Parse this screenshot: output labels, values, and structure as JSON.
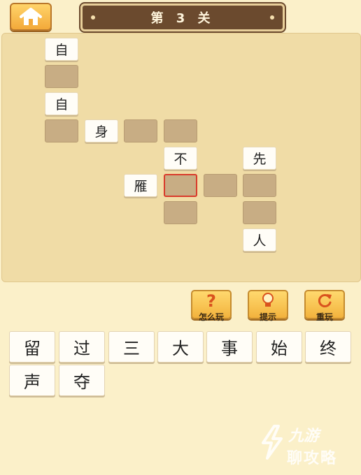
{
  "header": {
    "title": "第 3 关",
    "home_icon": "home-icon"
  },
  "board": {
    "cells": [
      {
        "id": "r1c1",
        "char": "自",
        "state": "given"
      },
      {
        "id": "r2c1",
        "char": "",
        "state": "empty"
      },
      {
        "id": "r3c1",
        "char": "自",
        "state": "given"
      },
      {
        "id": "r4c1",
        "char": "",
        "state": "empty"
      },
      {
        "id": "r4c2",
        "char": "身",
        "state": "given"
      },
      {
        "id": "r4c3",
        "char": "",
        "state": "empty"
      },
      {
        "id": "r4c4",
        "char": "",
        "state": "empty"
      },
      {
        "id": "r5c4",
        "char": "不",
        "state": "given"
      },
      {
        "id": "r5c6",
        "char": "先",
        "state": "given"
      },
      {
        "id": "r6c3",
        "char": "雁",
        "state": "given"
      },
      {
        "id": "r6c4",
        "char": "",
        "state": "selected"
      },
      {
        "id": "r6c5",
        "char": "",
        "state": "empty"
      },
      {
        "id": "r6c6",
        "char": "",
        "state": "empty"
      },
      {
        "id": "r7c4",
        "char": "",
        "state": "empty"
      },
      {
        "id": "r7c6",
        "char": "",
        "state": "empty"
      },
      {
        "id": "r8c6",
        "char": "人",
        "state": "given"
      }
    ]
  },
  "tools": [
    {
      "label": "怎么玩",
      "icon": "question-icon"
    },
    {
      "label": "提示",
      "icon": "lightbulb-icon"
    },
    {
      "label": "重玩",
      "icon": "refresh-icon"
    }
  ],
  "candidates": [
    "留",
    "过",
    "三",
    "大",
    "事",
    "始",
    "终",
    "声",
    "夺"
  ],
  "watermark": {
    "brand": "九游",
    "sub": "聊攻略"
  }
}
